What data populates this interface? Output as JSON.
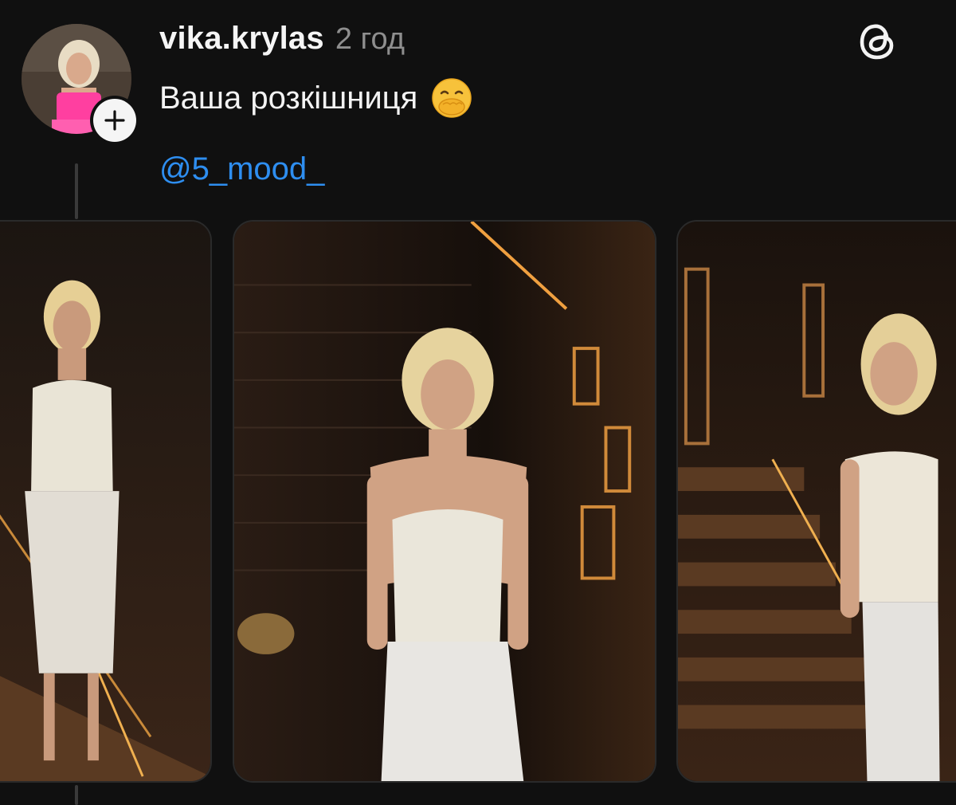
{
  "post": {
    "username": "vika.krylas",
    "time": "2 год",
    "caption": "Ваша розкішниця",
    "caption_emoji": "hand-over-mouth-emoji",
    "mention": "@5_mood_"
  },
  "icons": {
    "follow": "plus-icon",
    "app": "threads-logo-icon"
  },
  "colors": {
    "background": "#101010",
    "mention": "#2e8ef0",
    "meta_text": "#8e8e8e"
  },
  "carousel": {
    "photos": [
      {
        "name": "photo-1"
      },
      {
        "name": "photo-2"
      },
      {
        "name": "photo-3"
      }
    ]
  }
}
